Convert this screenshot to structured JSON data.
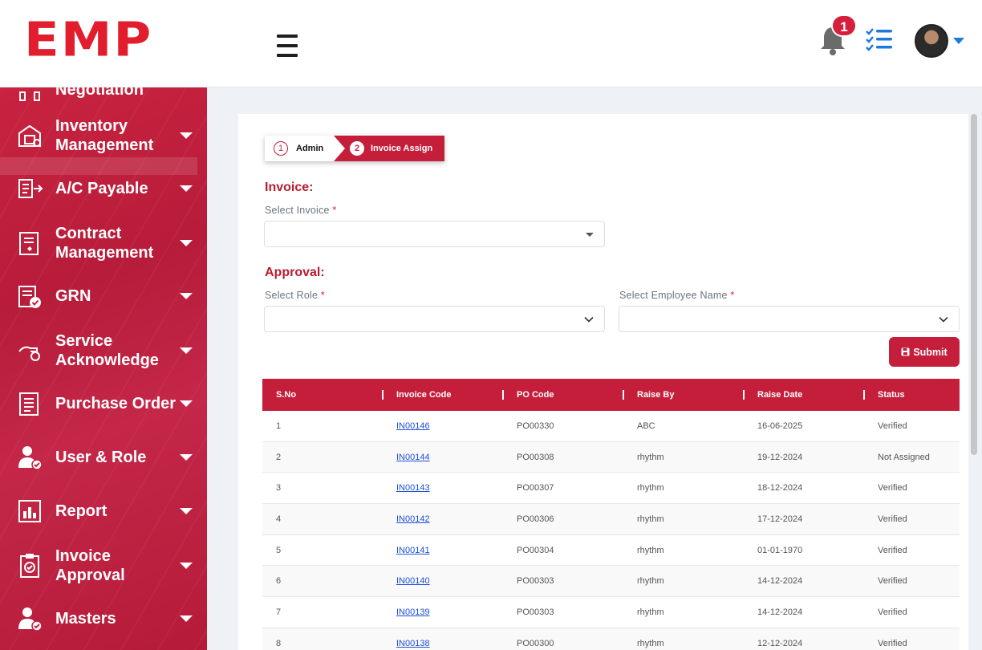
{
  "header": {
    "logo_text": "EMP",
    "notification_count": "1",
    "icons": [
      "bell-icon",
      "task-list-icon",
      "user-avatar",
      "chevron-down-icon",
      "menu-icon"
    ]
  },
  "sidebar": {
    "items": [
      {
        "label": "Negotiation",
        "icon": "negotiation-icon"
      },
      {
        "label": "Inventory\nManagement",
        "icon": "inventory-icon"
      },
      {
        "label": "A/C Payable",
        "icon": "payable-icon"
      },
      {
        "label": "Contract\nManagement",
        "icon": "contract-icon"
      },
      {
        "label": "GRN",
        "icon": "grn-icon"
      },
      {
        "label": "Service\nAcknowledge",
        "icon": "service-icon"
      },
      {
        "label": "Purchase Order",
        "icon": "purchase-order-icon"
      },
      {
        "label": "User & Role",
        "icon": "user-role-icon"
      },
      {
        "label": "Report",
        "icon": "report-icon"
      },
      {
        "label": "Invoice\nApproval",
        "icon": "invoice-approval-icon"
      },
      {
        "label": "Masters",
        "icon": "masters-icon"
      }
    ]
  },
  "stepper": {
    "step1": {
      "num": "1",
      "label": "Admin"
    },
    "step2": {
      "num": "2",
      "label": "Invoice Assign"
    }
  },
  "form": {
    "invoice_title": "Invoice:",
    "select_invoice_label": "Select Invoice",
    "approval_title": "Approval:",
    "select_role_label": "Select Role",
    "select_employee_label": "Select Employee Name",
    "required_mark": "*",
    "submit_label": "Submit"
  },
  "table": {
    "headers": [
      "S.No",
      "Invoice Code",
      "PO Code",
      "Raise By",
      "Raise Date",
      "Status"
    ],
    "rows": [
      [
        "1",
        "IN00146",
        "PO00330",
        "ABC",
        "16-06-2025",
        "Verified"
      ],
      [
        "2",
        "IN00144",
        "PO00308",
        "rhythm",
        "19-12-2024",
        "Not Assigned"
      ],
      [
        "3",
        "IN00143",
        "PO00307",
        "rhythm",
        "18-12-2024",
        "Verified"
      ],
      [
        "4",
        "IN00142",
        "PO00306",
        "rhythm",
        "17-12-2024",
        "Verified"
      ],
      [
        "5",
        "IN00141",
        "PO00304",
        "rhythm",
        "01-01-1970",
        "Verified"
      ],
      [
        "6",
        "IN00140",
        "PO00303",
        "rhythm",
        "14-12-2024",
        "Verified"
      ],
      [
        "7",
        "IN00139",
        "PO00303",
        "rhythm",
        "14-12-2024",
        "Verified"
      ],
      [
        "8",
        "IN00138",
        "PO00300",
        "rhythm",
        "12-12-2024",
        "Verified"
      ]
    ]
  },
  "colors": {
    "brand_red": "#c41e3a",
    "logo_red": "#e11d2e",
    "link_blue": "#1d4ed8",
    "accent_blue": "#1f7ae0"
  }
}
